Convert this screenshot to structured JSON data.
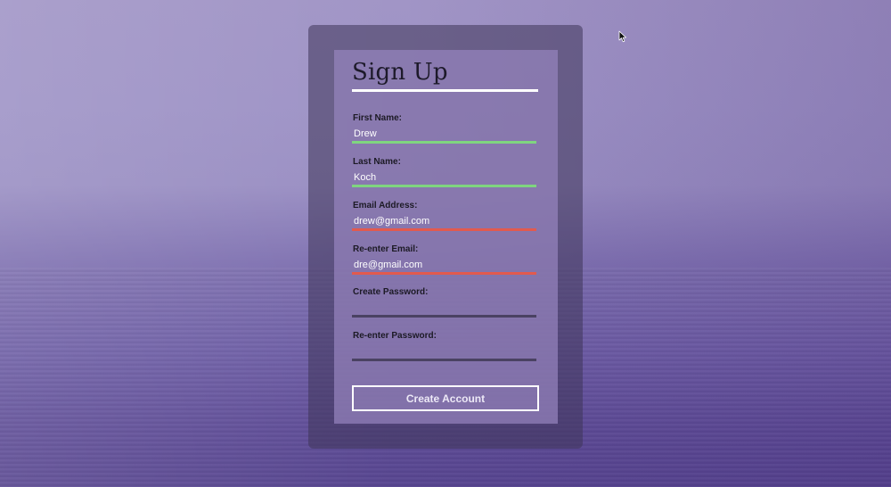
{
  "form": {
    "title": "Sign Up",
    "fields": [
      {
        "label": "First Name:",
        "value": "Drew",
        "status": "valid"
      },
      {
        "label": "Last Name:",
        "value": "Koch",
        "status": "valid"
      },
      {
        "label": "Email Address:",
        "value": "drew@gmail.com",
        "status": "invalid"
      },
      {
        "label": "Re-enter Email:",
        "value": "dre@gmail.com",
        "status": "invalid"
      },
      {
        "label": "Create Password:",
        "value": "",
        "status": "neutral"
      },
      {
        "label": "Re-enter Password:",
        "value": "",
        "status": "neutral"
      }
    ],
    "submit_label": "Create Account"
  },
  "colors": {
    "valid": "#7fd57f",
    "invalid": "#e25a4e",
    "neutral": "#4a4262"
  },
  "icons": {
    "cursor": "mouse-pointer-icon"
  }
}
